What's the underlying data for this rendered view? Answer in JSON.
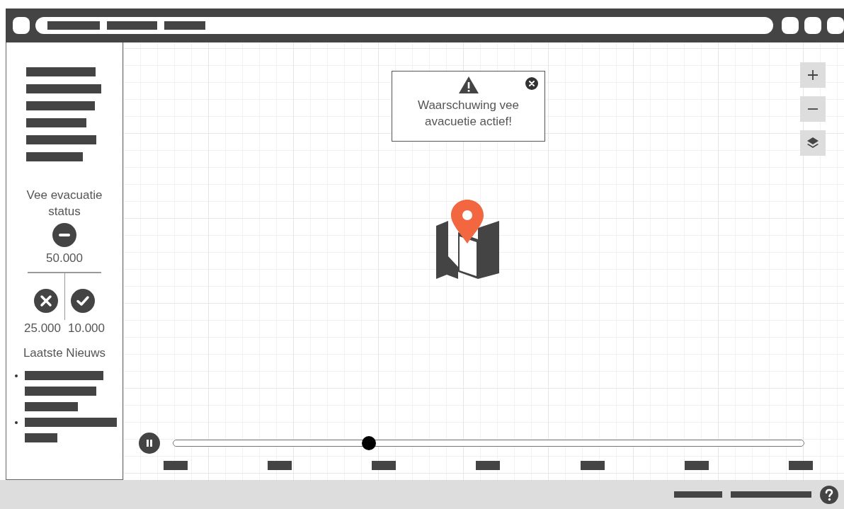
{
  "status_panel": {
    "title": "Vee evacuatie status",
    "total": "50.000",
    "failed": "25.000",
    "succeeded": "10.000"
  },
  "news": {
    "title": "Laatste Nieuws"
  },
  "alert": {
    "message": "Waarschuwing vee avacuetie actief!"
  },
  "timeline": {
    "playing": true,
    "level": 0.31
  }
}
